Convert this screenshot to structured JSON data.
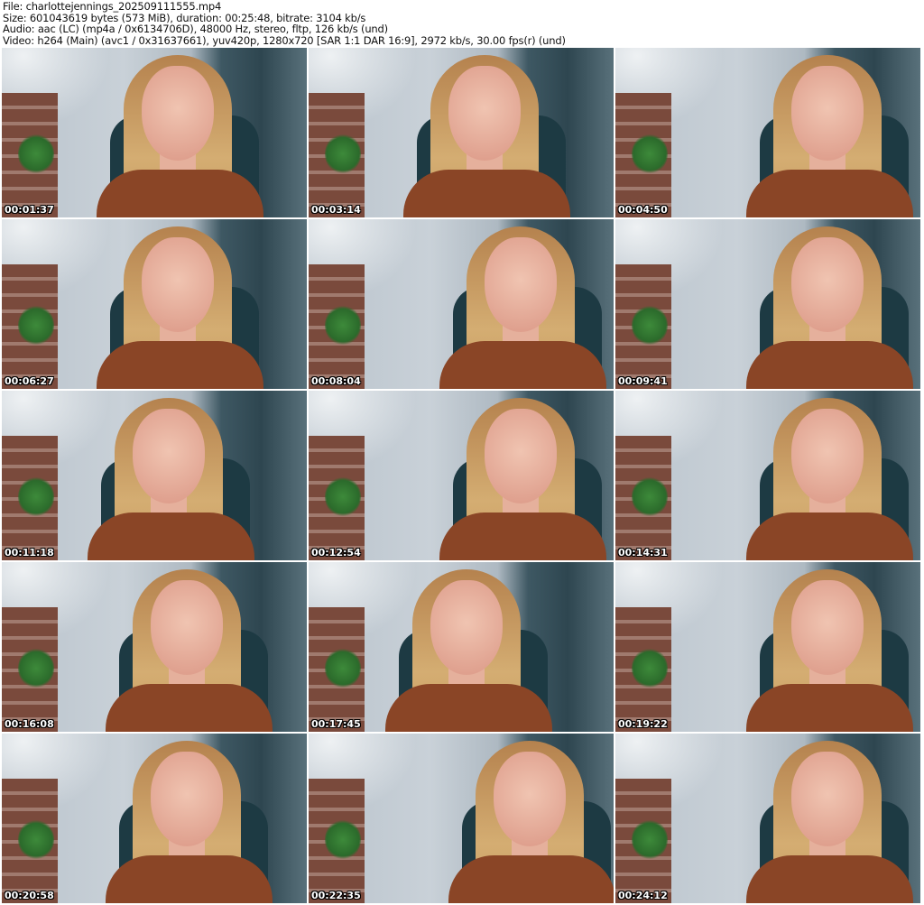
{
  "header": {
    "file": "File: charlottejennings_202509111555.mp4",
    "size": "Size: 601043619 bytes (573 MiB), duration: 00:25:48, bitrate: 3104 kb/s",
    "audio": "Audio: aac (LC) (mp4a / 0x6134706D), 48000 Hz, stereo, fltp, 126 kb/s (und)",
    "video": "Video: h264 (Main) (avc1 / 0x31637661), yuv420p, 1280x720 [SAR 1:1 DAR 16:9], 2972 kb/s, 30.00 fps(r) (und)"
  },
  "thumbnails": [
    "00:01:37",
    "00:03:14",
    "00:04:50",
    "00:06:27",
    "00:08:04",
    "00:09:41",
    "00:11:18",
    "00:12:54",
    "00:14:31",
    "00:16:08",
    "00:17:45",
    "00:19:22",
    "00:20:58",
    "00:22:35",
    "00:24:12"
  ]
}
